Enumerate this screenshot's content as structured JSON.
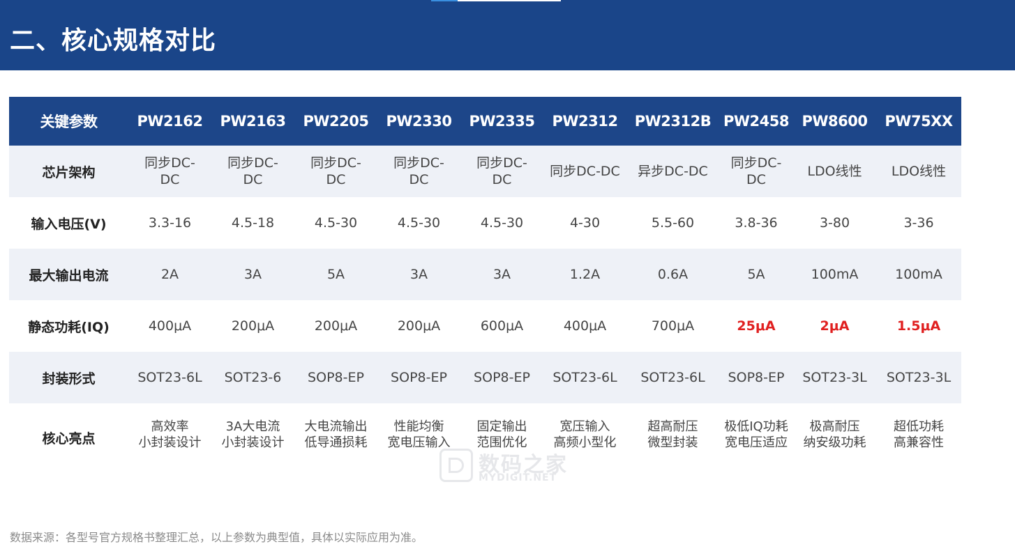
{
  "section": {
    "title": "二、核心规格对比"
  },
  "table": {
    "header": [
      "关键参数",
      "PW2162",
      "PW2163",
      "PW2205",
      "PW2330",
      "PW2335",
      "PW2312",
      "PW2312B",
      "PW2458",
      "PW8600",
      "PW75XX"
    ],
    "rows": [
      {
        "label": "芯片架构",
        "cells": [
          "同步DC-\nDC",
          "同步DC-\nDC",
          "同步DC-\nDC",
          "同步DC-\nDC",
          "同步DC-\nDC",
          "同步DC-DC",
          "异步DC-DC",
          "同步DC-\nDC",
          "LDO线性",
          "LDO线性"
        ]
      },
      {
        "label": "输入电压(V)",
        "cells": [
          "3.3-16",
          "4.5-18",
          "4.5-30",
          "4.5-30",
          "4.5-30",
          "4-30",
          "5.5-60",
          "3.8-36",
          "3-80",
          "3-36"
        ]
      },
      {
        "label": "最大输出电流",
        "cells": [
          "2A",
          "3A",
          "5A",
          "3A",
          "3A",
          "1.2A",
          "0.6A",
          "5A",
          "100mA",
          "100mA"
        ]
      },
      {
        "label": "静态功耗(IQ)",
        "cells": [
          "400μA",
          "200μA",
          "200μA",
          "200μA",
          "600μA",
          "400μA",
          "700μA",
          "25μA",
          "2μA",
          "1.5μA"
        ]
      },
      {
        "label": "封装形式",
        "cells": [
          "SOT23-6L",
          "SOT23-6",
          "SOP8-EP",
          "SOP8-EP",
          "SOP8-EP",
          "SOT23-6L",
          "SOT23-6L",
          "SOP8-EP",
          "SOT23-3L",
          "SOT23-3L"
        ]
      },
      {
        "label": "核心亮点",
        "cells": [
          "高效率\n小封装设计",
          "3A大电流\n小封装设计",
          "大电流输出\n低导通损耗",
          "性能均衡\n宽电压输入",
          "固定输出\n范围优化",
          "宽压输入\n高频小型化",
          "超高耐压\n微型封装",
          "极低IQ功耗\n宽电压适应",
          "极高耐压\n纳安级功耗",
          "超低功耗\n高兼容性"
        ]
      }
    ]
  },
  "highlight_color": "#e02020",
  "watermark": {
    "cn": "数码之家",
    "en": "MYDIGIT.NET"
  },
  "footnote": "数据来源：各型号官方规格书整理汇总，以上参数为典型值，具体以实际应用为准。"
}
